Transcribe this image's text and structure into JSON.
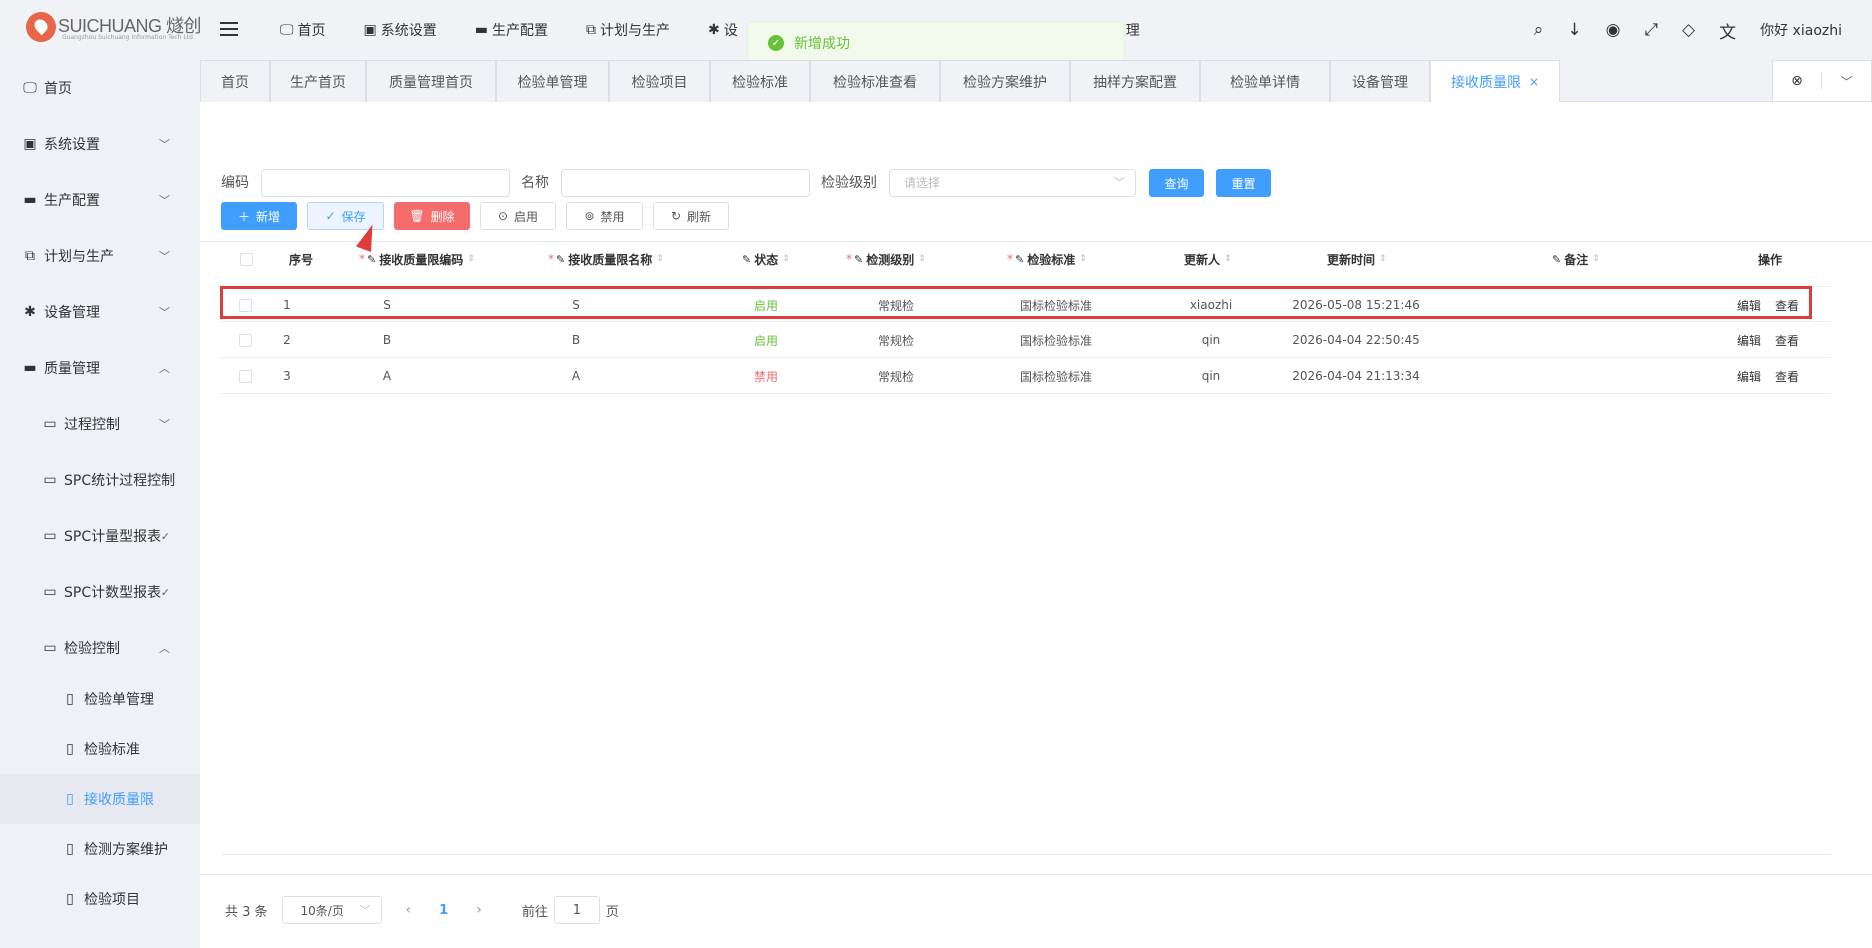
{
  "app": {
    "logo_text": "SUICHUANG 燧创",
    "logo_sub": "Guangzhou Suichuang Information Tech Ltd",
    "greeting": "你好 xiaozhi"
  },
  "topnav": [
    {
      "label": "首页",
      "icon": "monitor-icon"
    },
    {
      "label": "系统设置",
      "icon": "user-badge-icon"
    },
    {
      "label": "生产配置",
      "icon": "briefcase-icon"
    },
    {
      "label": "计划与生产",
      "icon": "windows-icon"
    },
    {
      "label": "设",
      "icon": "asterisk-icon"
    },
    {
      "label": "理",
      "icon": ""
    }
  ],
  "toast": {
    "text": "新增成功"
  },
  "sidebar": [
    {
      "label": "首页",
      "icon": "monitor-icon",
      "chevron": ""
    },
    {
      "label": "系统设置",
      "icon": "user-badge-icon",
      "chevron": "down"
    },
    {
      "label": "生产配置",
      "icon": "briefcase-icon",
      "chevron": "down"
    },
    {
      "label": "计划与生产",
      "icon": "windows-icon",
      "chevron": "down"
    },
    {
      "label": "设备管理",
      "icon": "asterisk-icon",
      "chevron": "down"
    },
    {
      "label": "质量管理",
      "icon": "briefcase-icon",
      "chevron": "up"
    },
    {
      "label": "过程控制",
      "icon": "folder-icon",
      "chevron": "down"
    },
    {
      "label": "SPC统计过程控制",
      "icon": "folder-icon",
      "chevron": ""
    },
    {
      "label": "SPC计量型报表",
      "icon": "folder-icon",
      "chevron": "check"
    },
    {
      "label": "SPC计数型报表",
      "icon": "folder-icon",
      "chevron": "check"
    },
    {
      "label": "检验控制",
      "icon": "folder-icon",
      "chevron": "up"
    },
    {
      "label": "检验单管理",
      "icon": "file-icon",
      "chevron": ""
    },
    {
      "label": "检验标准",
      "icon": "file-icon",
      "chevron": ""
    },
    {
      "label": "接收质量限",
      "icon": "file-icon",
      "chevron": "",
      "active": true
    },
    {
      "label": "检测方案维护",
      "icon": "file-icon",
      "chevron": ""
    },
    {
      "label": "检验项目",
      "icon": "file-icon",
      "chevron": ""
    }
  ],
  "tabs": [
    "首页",
    "生产首页",
    "质量管理首页",
    "检验单管理",
    "检验项目",
    "检验标准",
    "检验标准查看",
    "检验方案维护",
    "抽样方案配置",
    "检验单详情",
    "设备管理",
    "接收质量限"
  ],
  "search": {
    "code_label": "编码",
    "name_label": "名称",
    "level_label": "检验级别",
    "level_placeholder": "请选择",
    "query_btn": "查询",
    "reset_btn": "重置"
  },
  "toolbar": {
    "add": "新增",
    "save": "保存",
    "delete": "删除",
    "enable": "启用",
    "disable": "禁用",
    "refresh": "刷新"
  },
  "table": {
    "headers": {
      "seq": "序号",
      "code": "接收质量限编码",
      "name": "接收质量限名称",
      "status": "状态",
      "level": "检测级别",
      "standard": "检验标准",
      "updater": "更新人",
      "updated_at": "更新时间",
      "remark": "备注",
      "ops": "操作"
    },
    "rows": [
      {
        "seq": "1",
        "code": "S",
        "name": "S",
        "status": "启用",
        "level": "常规检",
        "standard": "国标检验标准",
        "updater": "xiaozhi",
        "updated_at": "2026-05-08 15:21:46",
        "remark": "",
        "edit": "编辑",
        "view": "查看"
      },
      {
        "seq": "2",
        "code": "B",
        "name": "B",
        "status": "启用",
        "level": "常规检",
        "standard": "国标检验标准",
        "updater": "qin",
        "updated_at": "2026-04-04 22:50:45",
        "remark": "",
        "edit": "编辑",
        "view": "查看"
      },
      {
        "seq": "3",
        "code": "A",
        "name": "A",
        "status": "禁用",
        "level": "常规检",
        "standard": "国标检验标准",
        "updater": "qin",
        "updated_at": "2026-04-04 21:13:34",
        "remark": "",
        "edit": "编辑",
        "view": "查看"
      }
    ]
  },
  "pager": {
    "total": "共 3 条",
    "page_size": "10条/页",
    "current": "1",
    "goto_label": "前往",
    "goto_value": "1",
    "page_suffix": "页"
  },
  "colors": {
    "primary": "#409eff",
    "danger": "#f56c6c",
    "success": "#67c23a",
    "highlight": "#e03c3c"
  }
}
